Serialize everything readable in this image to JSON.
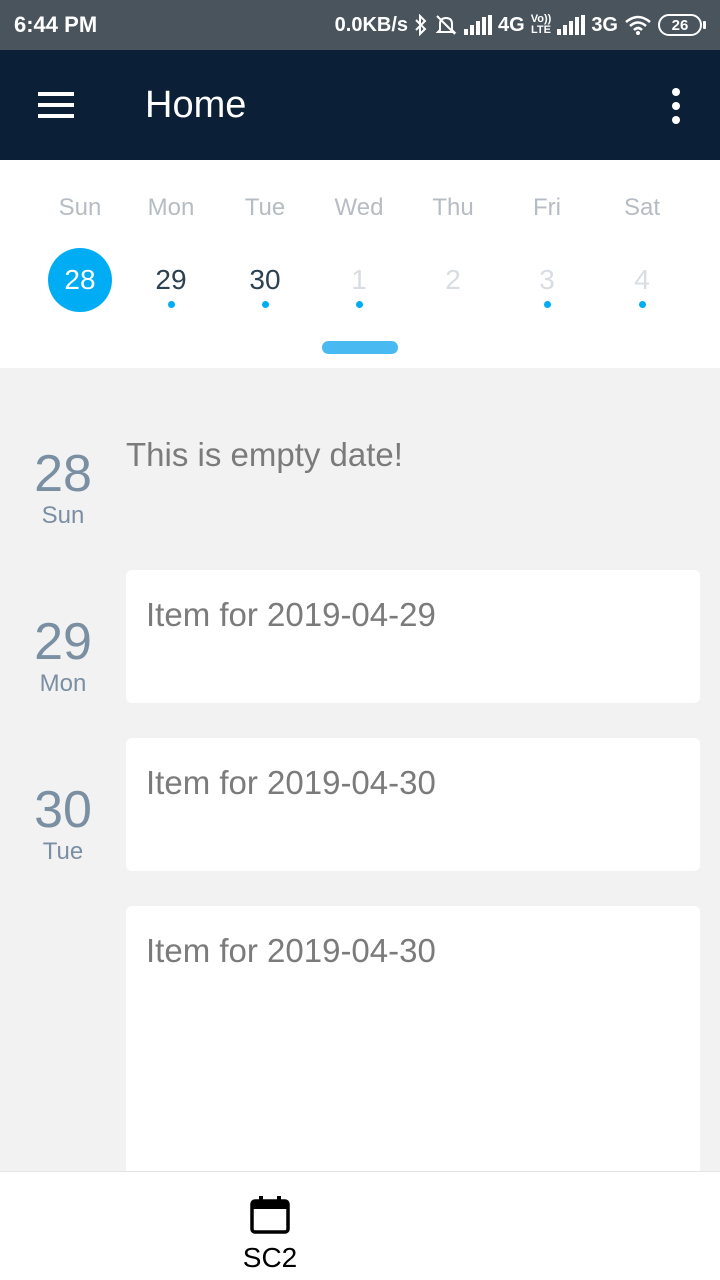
{
  "status_bar": {
    "time": "6:44 PM",
    "speed": "0.0KB/s",
    "network1": "4G",
    "volte_top": "Vo))",
    "volte_bottom": "LTE",
    "network2": "3G",
    "battery": "26"
  },
  "app_bar": {
    "title": "Home"
  },
  "week": {
    "days": [
      {
        "name": "Sun",
        "num": "28",
        "state": "selected",
        "dot": false
      },
      {
        "name": "Mon",
        "num": "29",
        "state": "normal",
        "dot": true
      },
      {
        "name": "Tue",
        "num": "30",
        "state": "normal",
        "dot": true
      },
      {
        "name": "Wed",
        "num": "1",
        "state": "faded",
        "dot": true
      },
      {
        "name": "Thu",
        "num": "2",
        "state": "faded",
        "dot": false
      },
      {
        "name": "Fri",
        "num": "3",
        "state": "faded",
        "dot": true
      },
      {
        "name": "Sat",
        "num": "4",
        "state": "faded",
        "dot": true
      }
    ]
  },
  "agenda": {
    "day1": {
      "num": "28",
      "name": "Sun",
      "empty_text": "This is empty date!"
    },
    "day2": {
      "num": "29",
      "name": "Mon",
      "item": "Item for 2019-04-29"
    },
    "day3": {
      "num": "30",
      "name": "Tue",
      "item": "Item for 2019-04-30",
      "item2": "Item for 2019-04-30"
    }
  },
  "bottom_nav": {
    "tab_label": "SC2"
  },
  "colors": {
    "accent": "#00adf5",
    "app_bar": "#0b1f36",
    "status_bar": "#4a545c",
    "background": "#f2f2f2"
  },
  "icons": [
    "menu-icon",
    "more-icon",
    "bluetooth-icon",
    "mute-icon",
    "signal-icon",
    "wifi-icon",
    "battery-icon",
    "calendar-icon"
  ]
}
